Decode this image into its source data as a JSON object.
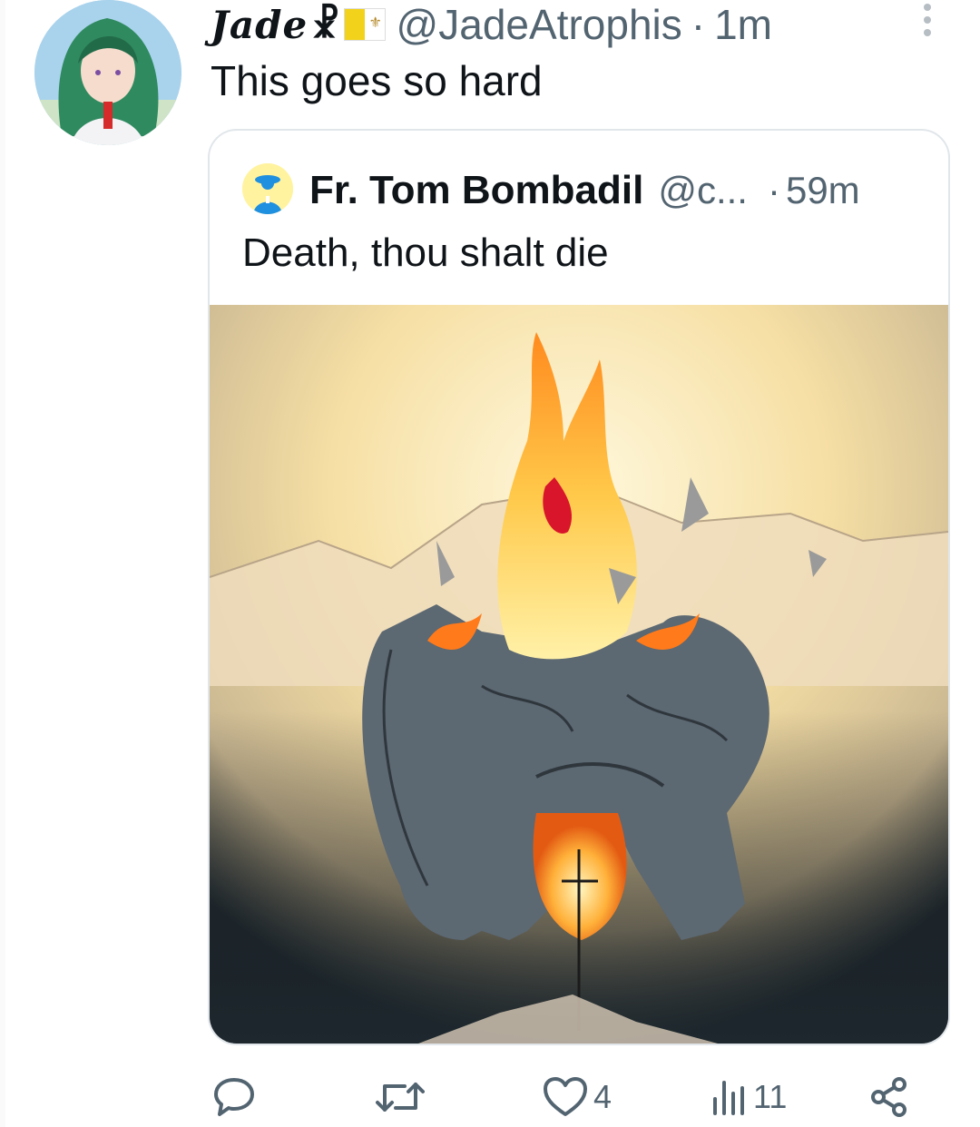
{
  "tweet": {
    "display_name": "Jade",
    "name_symbol": "☧",
    "handle": "@JadeAtrophis",
    "separator": "·",
    "time": "1m",
    "text": "This goes so hard"
  },
  "quoted": {
    "display_name": "Fr. Tom Bombadil",
    "handle": "@c...",
    "separator": "·",
    "time": "59m",
    "text": "Death, thou shalt die",
    "image": {
      "description_icon": "flaming-skull-artwork"
    }
  },
  "actions": {
    "reply": {
      "icon": "reply-icon",
      "count": ""
    },
    "retweet": {
      "icon": "retweet-icon",
      "count": ""
    },
    "like": {
      "icon": "heart-icon",
      "count": "4"
    },
    "views": {
      "icon": "analytics-icon",
      "count": "11"
    },
    "share": {
      "icon": "share-icon"
    }
  },
  "colors": {
    "text_primary": "#0f1419",
    "text_secondary": "#536471",
    "border": "#e1e6ea"
  }
}
